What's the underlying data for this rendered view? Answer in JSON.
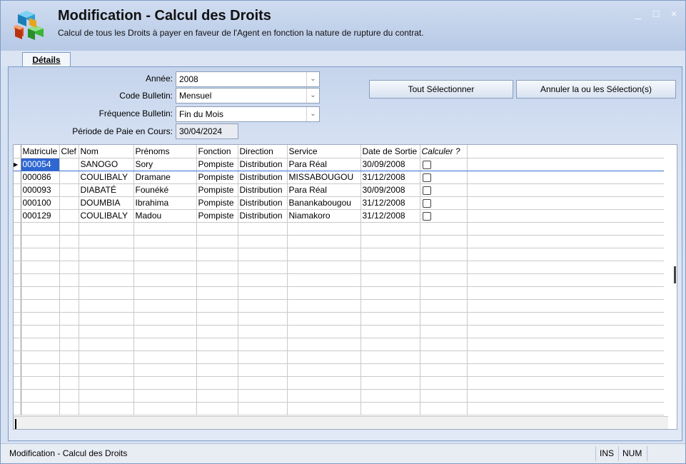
{
  "window": {
    "title": "Modification - Calcul des Droits",
    "subtitle": "Calcul de tous les Droits à payer en faveur de l'Agent en fonction la nature de rupture du contrat.",
    "controls": {
      "minimize": "_",
      "maximize": "□",
      "close": "×"
    }
  },
  "tabs": [
    {
      "label": "Détails",
      "active": true
    }
  ],
  "form": {
    "annee": {
      "label": "Année:",
      "value": "2008"
    },
    "code_bulletin": {
      "label": "Code Bulletin:",
      "value": "Mensuel"
    },
    "frequence": {
      "label": "Fréquence Bulletin:",
      "value": "Fin du Mois"
    },
    "periode": {
      "label": "Période de Paie en Cours:",
      "value": "30/04/2024"
    }
  },
  "buttons": {
    "select_all": "Tout Sélectionner",
    "cancel_selection": "Annuler la ou les Sélection(s)"
  },
  "grid": {
    "columns": [
      "Matricule",
      "Clef",
      "Nom",
      "Prénoms",
      "Fonction",
      "Direction",
      "Service",
      "Date de Sortie",
      "Calculer ?"
    ],
    "rows": [
      {
        "matricule": "000054",
        "clef": "",
        "nom": "SANOGO",
        "prenoms": "Sory",
        "fonction": "Pompiste",
        "direction": "Distribution",
        "service": "Para Réal",
        "date_sortie": "30/09/2008",
        "calculer": false
      },
      {
        "matricule": "000086",
        "clef": "",
        "nom": "COULIBALY",
        "prenoms": "Dramane",
        "fonction": "Pompiste",
        "direction": "Distribution",
        "service": "MISSABOUGOU",
        "date_sortie": "31/12/2008",
        "calculer": false
      },
      {
        "matricule": "000093",
        "clef": "",
        "nom": "DIABATÉ",
        "prenoms": "Founéké",
        "fonction": "Pompiste",
        "direction": "Distribution",
        "service": "Para Réal",
        "date_sortie": "30/09/2008",
        "calculer": false
      },
      {
        "matricule": "000100",
        "clef": "",
        "nom": "DOUMBIA",
        "prenoms": "Ibrahima",
        "fonction": "Pompiste",
        "direction": "Distribution",
        "service": "Banankabougou",
        "date_sortie": "31/12/2008",
        "calculer": false
      },
      {
        "matricule": "000129",
        "clef": "",
        "nom": "COULIBALY",
        "prenoms": "Madou",
        "fonction": "Pompiste",
        "direction": "Distribution",
        "service": "Niamakoro",
        "date_sortie": "31/12/2008",
        "calculer": false
      }
    ],
    "selected_row": 0,
    "empty_rows": 15
  },
  "statusbar": {
    "text": "Modification - Calcul des Droits",
    "ins": "INS",
    "num": "NUM"
  },
  "icons": {
    "logo": "colored-cubes-icon",
    "dropdown": "chevron-down-icon"
  }
}
